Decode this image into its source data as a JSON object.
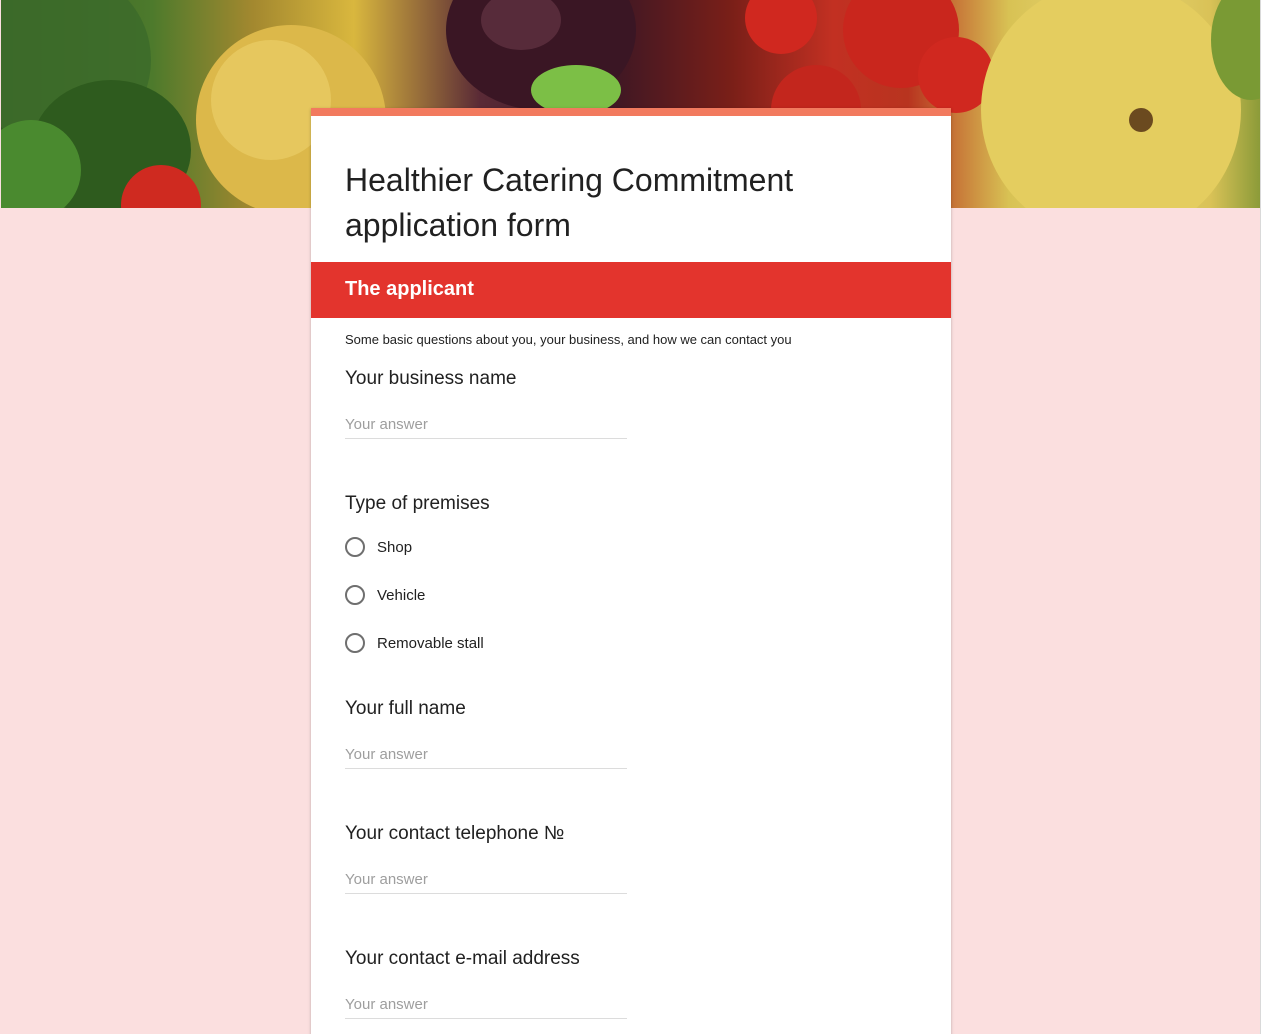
{
  "form": {
    "title": "Healthier Catering Commitment application form",
    "theme_color": "#e3342d",
    "accent_color": "#f27a5e",
    "background_color": "#fbdfdf"
  },
  "header_image": {
    "icon": "vegetables-header-image"
  },
  "section": {
    "title": "The applicant",
    "description": "Some basic questions about you, your business, and how we can contact you"
  },
  "questions": {
    "business_name": {
      "label": "Your business name",
      "placeholder": "Your answer"
    },
    "premises_type": {
      "label": "Type of premises",
      "options": [
        "Shop",
        "Vehicle",
        "Removable stall"
      ]
    },
    "full_name": {
      "label": "Your full name",
      "placeholder": "Your answer"
    },
    "telephone": {
      "label": "Your contact telephone №",
      "placeholder": "Your answer"
    },
    "email": {
      "label": "Your contact e-mail address",
      "placeholder": "Your answer"
    }
  }
}
